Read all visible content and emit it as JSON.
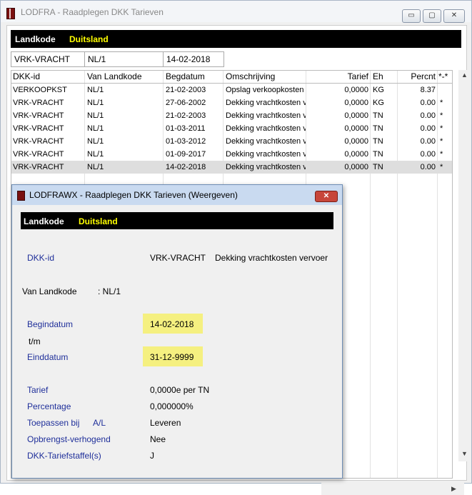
{
  "window": {
    "title": "LODFRA - Raadplegen DKK Tarieven",
    "min": "▭",
    "max": "▢",
    "close": "✕"
  },
  "header": {
    "label": "Landkode",
    "value": "Duitsland"
  },
  "filter": [
    "VRK-VRACHT",
    "NL/1",
    "14-02-2018"
  ],
  "table": {
    "columns": [
      "DKK-id",
      "Van Landkode",
      "Begdatum",
      "Omschrijving",
      "Tarief",
      "Eh",
      "Percnt",
      "*-*"
    ],
    "rows": [
      [
        "VERKOOPKST",
        "NL/1",
        "21-02-2003",
        "Opslag verkoopkosten",
        "0,0000",
        "KG",
        "8.37",
        ""
      ],
      [
        "VRK-VRACHT",
        "NL/1",
        "27-06-2002",
        "Dekking vrachtkosten v",
        "0,0000",
        "KG",
        "0.00",
        "*"
      ],
      [
        "VRK-VRACHT",
        "NL/1",
        "21-02-2003",
        "Dekking vrachtkosten v",
        "0,0000",
        "TN",
        "0.00",
        "*"
      ],
      [
        "VRK-VRACHT",
        "NL/1",
        "01-03-2011",
        "Dekking vrachtkosten v",
        "0,0000",
        "TN",
        "0.00",
        "*"
      ],
      [
        "VRK-VRACHT",
        "NL/1",
        "01-03-2012",
        "Dekking vrachtkosten v",
        "0,0000",
        "TN",
        "0.00",
        "*"
      ],
      [
        "VRK-VRACHT",
        "NL/1",
        "01-09-2017",
        "Dekking vrachtkosten v",
        "0,0000",
        "TN",
        "0.00",
        "*"
      ],
      [
        "VRK-VRACHT",
        "NL/1",
        "14-02-2018",
        "Dekking vrachtkosten v",
        "0,0000",
        "TN",
        "0.00",
        "*"
      ]
    ]
  },
  "dialog": {
    "title": "LODFRAWX - Raadplegen DKK Tarieven (Weergeven)",
    "close": "✕",
    "header_label": "Landkode",
    "header_value": "Duitsland",
    "dkk_id_label": "DKK-id",
    "dkk_id_value": "VRK-VRACHT",
    "dkk_desc": "Dekking vrachtkosten vervoer",
    "van_landkode": "Van Landkode",
    "van_landkode_value": ": NL/1",
    "begindatum_label": "Begindatum",
    "begindatum_value": "14-02-2018",
    "tm": "t/m",
    "einddatum_label": "Einddatum",
    "einddatum_value": "31-12-9999",
    "tarief_label": "Tarief",
    "tarief_value": "0,0000e per TN",
    "percentage_label": "Percentage",
    "percentage_value": "0,000000%",
    "toepassen_label": "Toepassen bij",
    "toepassen_al": "A/L",
    "toepassen_value": "Leveren",
    "opbrengst_label": "Opbrengst-verhogend",
    "opbrengst_value": "Nee",
    "staffel_label": "DKK-Tariefstaffel(s)",
    "staffel_value": "J"
  }
}
